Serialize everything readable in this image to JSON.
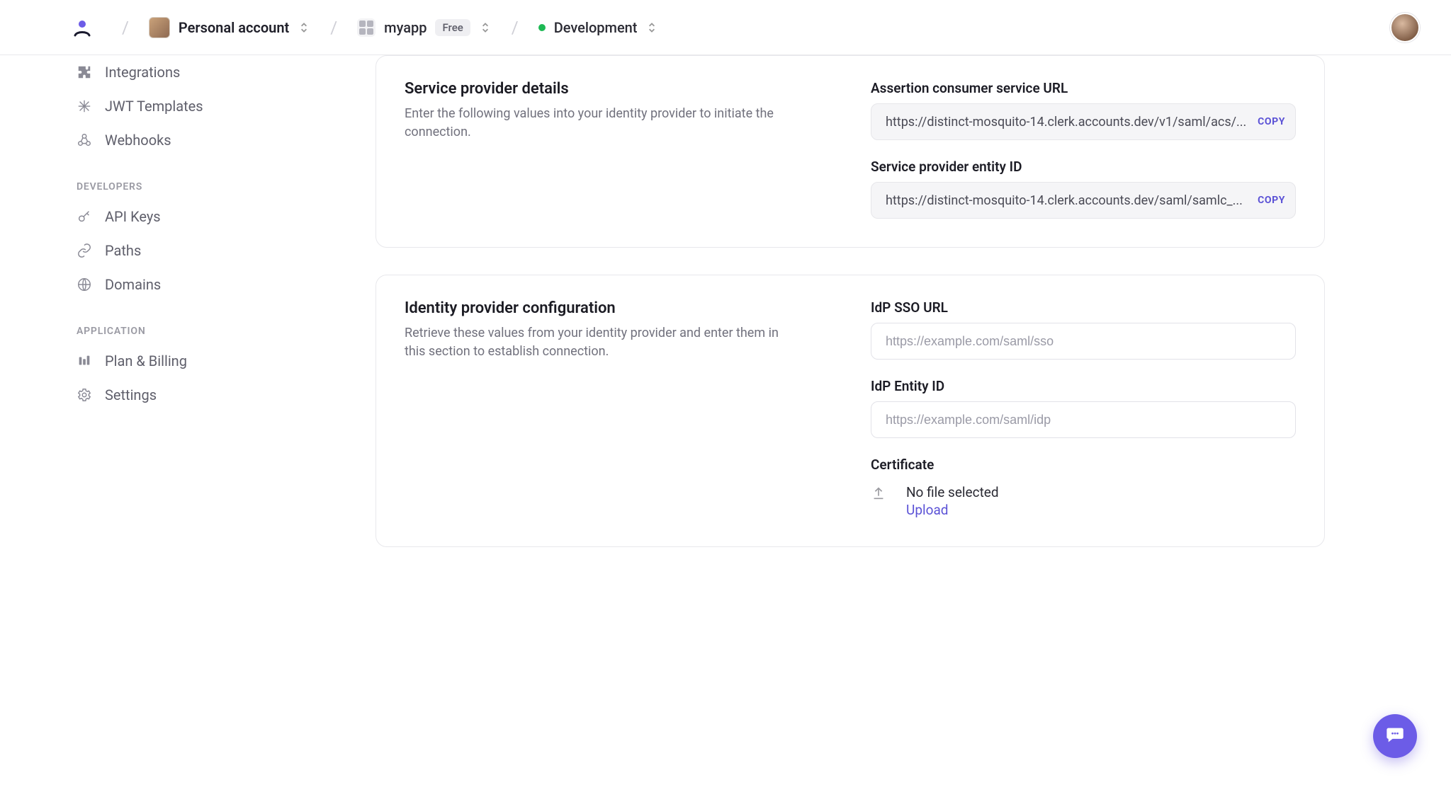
{
  "breadcrumb": {
    "account_label": "Personal account",
    "app_name": "myapp",
    "app_plan": "Free",
    "environment": "Development"
  },
  "sidebar": {
    "main_items": [
      {
        "label": "Integrations",
        "icon": "integrations"
      },
      {
        "label": "JWT Templates",
        "icon": "jwt"
      },
      {
        "label": "Webhooks",
        "icon": "webhooks"
      }
    ],
    "dev_header": "DEVELOPERS",
    "dev_items": [
      {
        "label": "API Keys",
        "icon": "key"
      },
      {
        "label": "Paths",
        "icon": "link"
      },
      {
        "label": "Domains",
        "icon": "globe"
      }
    ],
    "app_header": "APPLICATION",
    "app_items": [
      {
        "label": "Plan & Billing",
        "icon": "billing"
      },
      {
        "label": "Settings",
        "icon": "gear"
      }
    ]
  },
  "sp_card": {
    "title": "Service provider details",
    "desc": "Enter the following values into your identity provider to initiate the connection.",
    "acs_label": "Assertion consumer service URL",
    "acs_value": "https://distinct-mosquito-14.clerk.accounts.dev/v1/saml/acs/...",
    "entity_label": "Service provider entity ID",
    "entity_value": "https://distinct-mosquito-14.clerk.accounts.dev/saml/samlc_...",
    "copy": "COPY"
  },
  "idp_card": {
    "title": "Identity provider configuration",
    "desc": "Retrieve these values from your identity provider and enter them in this section to establish connection.",
    "sso_label": "IdP SSO URL",
    "sso_placeholder": "https://example.com/saml/sso",
    "entity_label": "IdP Entity ID",
    "entity_placeholder": "https://example.com/saml/idp",
    "cert_label": "Certificate",
    "cert_empty": "No file selected",
    "cert_action": "Upload"
  }
}
